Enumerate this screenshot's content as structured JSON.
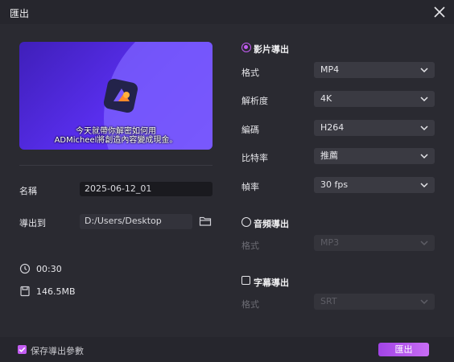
{
  "window": {
    "title": "匯出"
  },
  "preview": {
    "subtitle_line1": "今天就帶你解密如何用",
    "subtitle_line2": "ADMicheel將創造內容變成現金。"
  },
  "left": {
    "name_label": "名稱",
    "name_value": "2025-06-12_01",
    "export_to_label": "導出到",
    "export_path": "D:/Users/Desktop",
    "duration": "00:30",
    "size": "146.5MB"
  },
  "video_export": {
    "heading": "影片導出",
    "selected": true,
    "format_label": "格式",
    "format_value": "MP4",
    "resolution_label": "解析度",
    "resolution_value": "4K",
    "codec_label": "編碼",
    "codec_value": "H264",
    "bitrate_label": "比特率",
    "bitrate_value": "推薦",
    "framerate_label": "幀率",
    "framerate_value": "30  fps"
  },
  "audio_export": {
    "heading": "音頻導出",
    "selected": false,
    "format_label": "格式",
    "format_value": "MP3"
  },
  "subtitle_export": {
    "heading": "字幕導出",
    "checked": false,
    "format_label": "格式",
    "format_value": "SRT"
  },
  "footer": {
    "save_params_label": "保存導出參數",
    "save_params_checked": true,
    "export_button": "匯出"
  },
  "colors": {
    "accent": "#c35cf2",
    "background": "#2a2a31"
  },
  "icons": [
    "close-icon",
    "app-logo-icon",
    "folder-icon",
    "clock-icon",
    "file-size-icon",
    "chevron-down-icon"
  ]
}
